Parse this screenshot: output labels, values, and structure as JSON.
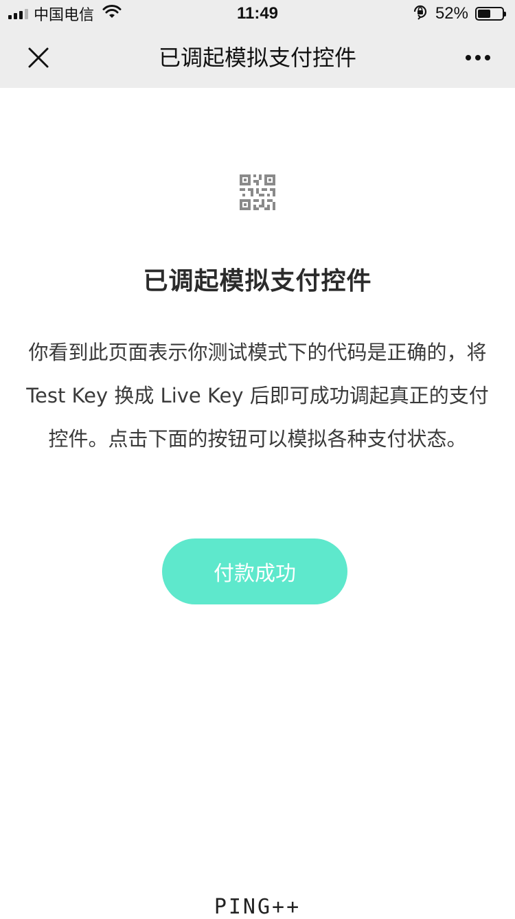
{
  "status_bar": {
    "carrier": "中国电信",
    "time": "11:49",
    "battery_percent": "52%",
    "battery_level": 0.52,
    "icons": [
      "signal-icon",
      "wifi-icon",
      "orientation-lock-icon",
      "battery-icon"
    ]
  },
  "nav": {
    "title": "已调起模拟支付控件",
    "close_icon": "close-icon",
    "more_icon": "more-icon"
  },
  "content": {
    "icon": "qr-code-icon",
    "title": "已调起模拟支付控件",
    "description": "你看到此页面表示你测试模式下的代码是正确的，将 Test Key 换成 Live Key 后即可成功调起真正的支付控件。点击下面的按钮可以模拟各种支付状态。",
    "button_label": "付款成功"
  },
  "footer": {
    "logo_text": "PING++"
  },
  "colors": {
    "bar_background": "#ededed",
    "button_background": "#5ee8cc",
    "button_text": "#ffffff"
  }
}
